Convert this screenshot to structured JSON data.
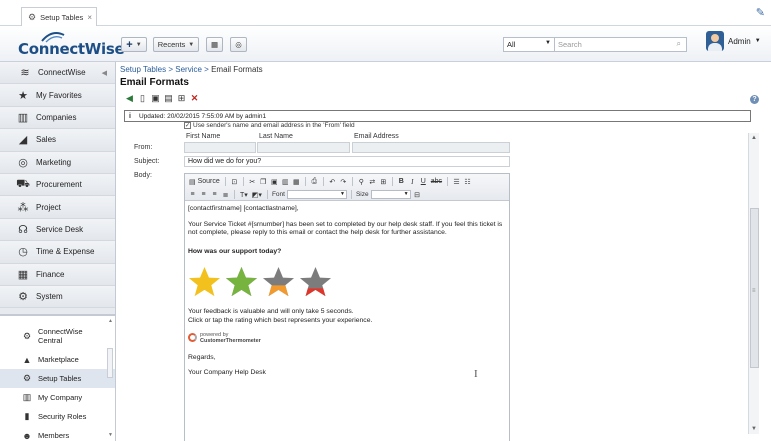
{
  "tab": {
    "label": "Setup Tables"
  },
  "topbar": {
    "logo": "ConnectWise",
    "recents_label": "Recents",
    "search_scope": "All",
    "search_placeholder": "Search",
    "user_name": "Admin"
  },
  "sidebar": {
    "items": [
      {
        "label": "ConnectWise",
        "icon": "connectwise-logo-icon"
      },
      {
        "label": "My Favorites",
        "icon": "star-icon"
      },
      {
        "label": "Companies",
        "icon": "building-icon"
      },
      {
        "label": "Sales",
        "icon": "chart-icon"
      },
      {
        "label": "Marketing",
        "icon": "target-icon"
      },
      {
        "label": "Procurement",
        "icon": "cart-icon"
      },
      {
        "label": "Project",
        "icon": "project-icon"
      },
      {
        "label": "Service Desk",
        "icon": "headset-icon"
      },
      {
        "label": "Time & Expense",
        "icon": "time-expense-icon"
      },
      {
        "label": "Finance",
        "icon": "grid-icon"
      },
      {
        "label": "System",
        "icon": "gears-icon"
      }
    ],
    "sub_items": [
      {
        "label1": "ConnectWise",
        "label2": "Central",
        "icon": "gear-icon"
      },
      {
        "label": "Marketplace",
        "icon": "bag-icon"
      },
      {
        "label": "Setup Tables",
        "icon": "gear-icon",
        "active": true
      },
      {
        "label": "My Company",
        "icon": "building-icon"
      },
      {
        "label": "Security Roles",
        "icon": "chart-icon"
      },
      {
        "label": "Members",
        "icon": "people-icon"
      }
    ]
  },
  "page": {
    "breadcrumb": {
      "a": "Setup Tables",
      "sep": ">",
      "b": "Service",
      "c": "Email Formats"
    },
    "title": "Email Formats",
    "updated_text": "Updated: 20/02/2015 7:55:09 AM by admin1",
    "sender_text": "Use sender's name and email address in the 'From' field",
    "from_label": "From:",
    "subject_label": "Subject:",
    "body_label": "Body:",
    "col_first": "First Name",
    "col_last": "Last Name",
    "col_email": "Email Address",
    "subject_value": "How did we do for you?"
  },
  "editor": {
    "source_label": "Source",
    "font_label": "Font",
    "size_label": "Size",
    "line1": "[contactfirstname] [contactlastname],",
    "line2": "Your Service Ticket #[srnumber] has been set to completed by our help desk staff.  If you feel this ticket is not complete, please reply to this email or contact the help desk for further assistance.",
    "question": "How was our support today?",
    "star_colors": [
      "#f2c11d",
      "#77b43f",
      "#f29a2e",
      "#e0352b"
    ],
    "feedback1": "Your feedback is valuable and will only take 5 seconds.",
    "feedback2": "Click or tap the rating which best represents your experience.",
    "ct_powered": "powered by",
    "ct_name": "CustomerThermometer",
    "regards": "Regards,",
    "signoff": "Your Company Help Desk"
  }
}
